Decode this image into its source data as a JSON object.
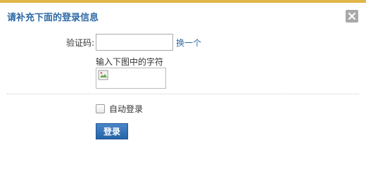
{
  "dialog": {
    "title": "请补充下面的登录信息",
    "close_label": "×"
  },
  "form": {
    "captcha_label": "验证码:",
    "captcha_value": "",
    "change_link": "换一个",
    "captcha_hint": "输入下图中的字符",
    "auto_login_label": "自动登录",
    "auto_login_checked": false,
    "login_button": "登录"
  },
  "icons": {
    "close": "close-icon",
    "captcha_image": "broken-image-icon"
  },
  "colors": {
    "title": "#2d6aa6",
    "link": "#2d6aa6",
    "button": "#2563a8",
    "close_bg": "#a9a9a9",
    "top_strip": "#e0b64a"
  }
}
